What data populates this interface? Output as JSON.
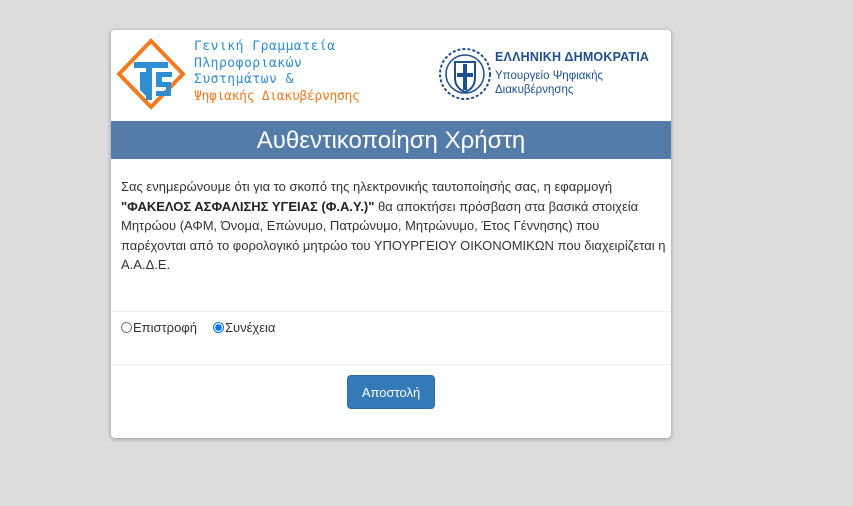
{
  "header": {
    "gsis_lines": [
      "Γενική Γραμματεία",
      "Πληροφοριακών",
      "Συστημάτων &"
    ],
    "gsis_line_orange": "Ψηφιακής Διακυβέρνησης",
    "gov_title": "ΕΛΛΗΝΙΚΗ ΔΗΜΟΚΡΑΤΙΑ",
    "gov_sub_1": "Υπουργείο Ψηφιακής",
    "gov_sub_2": "Διακυβέρνησης"
  },
  "banner": {
    "title": "Αυθεντικοποίηση Χρήστη"
  },
  "message": {
    "intro": "Σας ενημερώνουμε ότι για το σκοπό της ηλεκτρονικής ταυτοποίησής σας, η εφαρμογή",
    "app_name": "\"ΦΑΚΕΛΟΣ ΑΣΦΑΛΙΣΗΣ ΥΓΕΙΑΣ (Φ.Α.Υ.)\"",
    "rest": "θα αποκτήσει πρόσβαση στα βασικά στοιχεία Μητρώου (ΑΦΜ, Όνομα, Επώνυμο, Πατρώνυμο, Μητρώνυμο, Έτος Γέννησης) που παρέχονται από το φορολογικό μητρώο του ΥΠΟΥΡΓΕΙΟΥ ΟΙΚΟΝΟΜΙΚΩΝ που διαχειρίζεται η Α.Α.Δ.Ε."
  },
  "choice": {
    "back_label": "Επιστροφή",
    "continue_label": "Συνέχεια",
    "selected": "continue"
  },
  "form": {
    "submit_label": "Αποστολή"
  },
  "colors": {
    "banner": "#547ca8",
    "button": "#337ab7",
    "gsis_blue": "#2f8ed1",
    "gsis_orange": "#f07b22",
    "gov_blue": "#1f4f8f"
  },
  "icons": {
    "gsis_logo": "gsis-logo-icon",
    "gov_emblem": "greek-emblem-icon"
  }
}
